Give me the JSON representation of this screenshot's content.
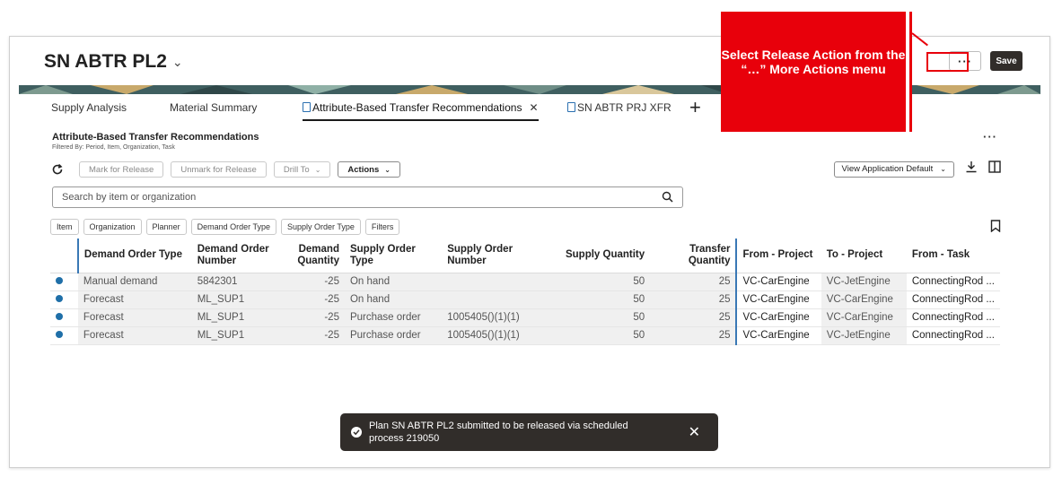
{
  "header": {
    "title": "SN ABTR PL2",
    "more_label": "···",
    "save_label": "Save"
  },
  "tabs": [
    {
      "label": "Supply Analysis"
    },
    {
      "label": "Material Summary"
    },
    {
      "label": "Attribute-Based Transfer Recommendations"
    },
    {
      "label": "SN ABTR PRJ XFR"
    }
  ],
  "section": {
    "title": "Attribute-Based Transfer Recommendations",
    "subtitle": "Filtered By: Period, Item, Organization, Task",
    "more_label": "···"
  },
  "toolbar": {
    "mark_release": "Mark for Release",
    "unmark_release": "Unmark for Release",
    "drill_to": "Drill To",
    "actions": "Actions",
    "view": "View Application Default"
  },
  "search": {
    "placeholder": "Search by item or organization"
  },
  "filters": [
    "Item",
    "Organization",
    "Planner",
    "Demand Order Type",
    "Supply Order Type",
    "Filters"
  ],
  "table": {
    "columns": [
      "Demand Order Type",
      "Demand Order Number",
      "Demand Quantity",
      "Supply Order Type",
      "Supply Order Number",
      "Supply Quantity",
      "Transfer Quantity",
      "From - Project",
      "To - Project",
      "From - Task"
    ],
    "rows": [
      [
        "Manual demand",
        "5842301",
        "-25",
        "On hand",
        "",
        "50",
        "25",
        "VC-CarEngine",
        "VC-JetEngine",
        "ConnectingRod ..."
      ],
      [
        "Forecast",
        "ML_SUP1",
        "-25",
        "On hand",
        "",
        "50",
        "25",
        "VC-CarEngine",
        "VC-CarEngine",
        "ConnectingRod ..."
      ],
      [
        "Forecast",
        "ML_SUP1",
        "-25",
        "Purchase order",
        "1005405()(1)(1)",
        "50",
        "25",
        "VC-CarEngine",
        "VC-CarEngine",
        "ConnectingRod ..."
      ],
      [
        "Forecast",
        "ML_SUP1",
        "-25",
        "Purchase order",
        "1005405()(1)(1)",
        "50",
        "25",
        "VC-CarEngine",
        "VC-JetEngine",
        "ConnectingRod ..."
      ]
    ],
    "status_color": "#1f6fa8"
  },
  "toast": {
    "message": "Plan SN ABTR PL2 submitted to be released via scheduled process 219050"
  },
  "callout": {
    "text": "Select Release Action from the “…” More Actions menu",
    "color": "#e8000b"
  }
}
